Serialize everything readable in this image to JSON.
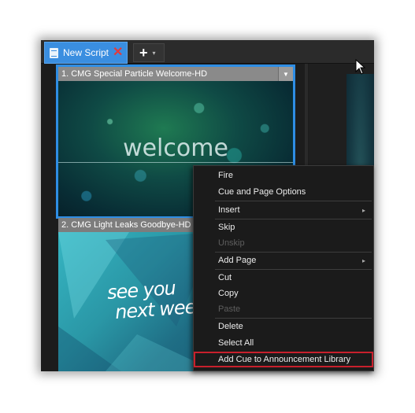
{
  "tabbar": {
    "tab_label": "New Script",
    "add_symbol": "+",
    "add_dropdown_symbol": "▾"
  },
  "cues": [
    {
      "title": "1. CMG Special Particle Welcome-HD",
      "thumbnail_text": "welcome",
      "selected": true
    },
    {
      "title": "2. CMG Light Leaks Goodbye-HD",
      "thumbnail_text_line1": "see you",
      "thumbnail_text_line2": "next week"
    }
  ],
  "context_menu": {
    "items": [
      {
        "label": "Fire",
        "enabled": true
      },
      {
        "label": "Cue and Page Options",
        "enabled": true
      },
      {
        "label": "Insert",
        "enabled": true,
        "submenu": true
      },
      {
        "label": "Skip",
        "enabled": true
      },
      {
        "label": "Unskip",
        "enabled": false
      },
      {
        "label": "Add Page",
        "enabled": true,
        "submenu": true
      },
      {
        "label": "Cut",
        "enabled": true
      },
      {
        "label": "Copy",
        "enabled": true
      },
      {
        "label": "Paste",
        "enabled": false
      },
      {
        "label": "Delete",
        "enabled": true
      },
      {
        "label": "Select All",
        "enabled": true
      },
      {
        "label": "Add Cue to Announcement Library",
        "enabled": true,
        "highlighted": true
      }
    ],
    "submenu_arrow": "▸"
  },
  "colors": {
    "tab_active": "#3a8ee0",
    "selection_border": "#2e8de4",
    "highlight_border": "#c8202c",
    "close_icon": "#e23b3b",
    "menu_bg": "#1b1b1b"
  },
  "icons": [
    "document-icon",
    "close-icon",
    "plus-icon",
    "chevron-down-icon",
    "submenu-arrow-icon",
    "mouse-cursor-icon"
  ]
}
